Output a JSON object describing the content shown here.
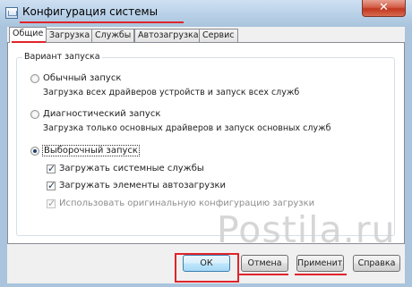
{
  "window": {
    "title": "Конфигурация системы",
    "close_glyph": "✕"
  },
  "tabs": [
    {
      "label": "Общие",
      "active": true
    },
    {
      "label": "Загрузка",
      "active": false
    },
    {
      "label": "Службы",
      "active": false
    },
    {
      "label": "Автозагрузка",
      "active": false
    },
    {
      "label": "Сервис",
      "active": false
    }
  ],
  "startup": {
    "group_label": "Вариант запуска",
    "normal": {
      "label": "Обычный запуск",
      "description": "Загрузка всех драйверов устройств и запуск всех служб",
      "selected": false
    },
    "diagnostic": {
      "label": "Диагностический запуск",
      "description": "Загрузка только основных драйверов и запуск основных служб",
      "selected": false
    },
    "selective": {
      "label": "Выборочный запуск",
      "selected": true,
      "options": [
        {
          "label": "Загружать системные службы",
          "checked": true,
          "enabled": true
        },
        {
          "label": "Загружать элементы автозагрузки",
          "checked": true,
          "enabled": true
        },
        {
          "label": "Использовать оригинальную конфигурацию загрузки",
          "checked": true,
          "enabled": false
        }
      ]
    }
  },
  "buttons": {
    "ok": "ОК",
    "cancel": "Отмена",
    "apply": "Применить",
    "help": "Справка"
  },
  "watermark": "Postila.ru",
  "colors": {
    "annotation_red": "#e0242a",
    "close_red": "#c0381f",
    "frame_blue": "#a9c4dc"
  }
}
